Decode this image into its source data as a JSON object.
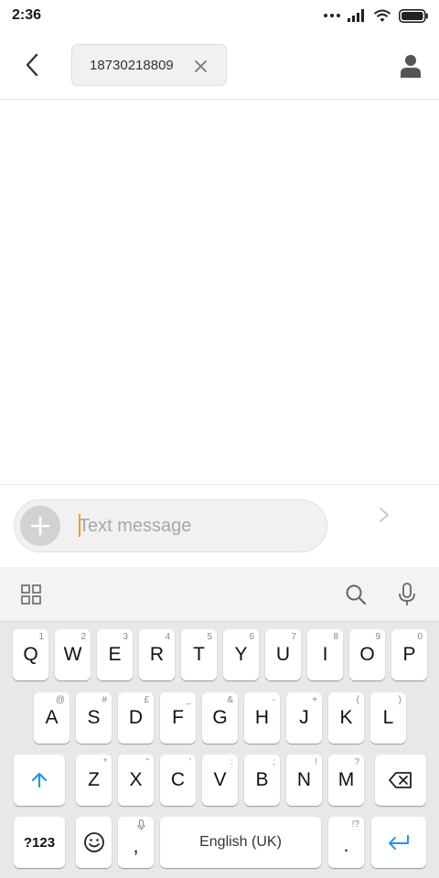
{
  "status_bar": {
    "time": "2:36"
  },
  "header": {
    "recipient": "18730218809"
  },
  "composer": {
    "placeholder": "Text message"
  },
  "keyboard": {
    "row1": [
      {
        "key": "Q",
        "sub": "1"
      },
      {
        "key": "W",
        "sub": "2"
      },
      {
        "key": "E",
        "sub": "3"
      },
      {
        "key": "R",
        "sub": "4"
      },
      {
        "key": "T",
        "sub": "5"
      },
      {
        "key": "Y",
        "sub": "6"
      },
      {
        "key": "U",
        "sub": "7"
      },
      {
        "key": "I",
        "sub": "8"
      },
      {
        "key": "O",
        "sub": "9"
      },
      {
        "key": "P",
        "sub": "0"
      }
    ],
    "row2": [
      {
        "key": "A",
        "sub": "@"
      },
      {
        "key": "S",
        "sub": "#"
      },
      {
        "key": "D",
        "sub": "£"
      },
      {
        "key": "F",
        "sub": "_"
      },
      {
        "key": "G",
        "sub": "&"
      },
      {
        "key": "H",
        "sub": "-"
      },
      {
        "key": "J",
        "sub": "+"
      },
      {
        "key": "K",
        "sub": "("
      },
      {
        "key": "L",
        "sub": ")"
      }
    ],
    "row3": [
      {
        "key": "Z",
        "sub": "*"
      },
      {
        "key": "X",
        "sub": "\""
      },
      {
        "key": "C",
        "sub": "'"
      },
      {
        "key": "V",
        "sub": ":"
      },
      {
        "key": "B",
        "sub": ";"
      },
      {
        "key": "N",
        "sub": "!"
      },
      {
        "key": "M",
        "sub": "?"
      }
    ],
    "symbols_label": "?123",
    "comma": ",",
    "period": ".",
    "period_sub": "!?",
    "space_label": "English (UK)"
  },
  "colors": {
    "accent": "#2196f3",
    "caret": "#f39c12"
  },
  "icons": {
    "back": "back-chevron-icon",
    "chip_remove": "close-icon",
    "contact": "person-icon",
    "attach": "plus-icon",
    "send": "send-chevron-icon",
    "grid": "grid-icon",
    "search": "search-icon",
    "mic": "microphone-icon",
    "shift": "shift-arrow-icon",
    "backspace": "backspace-icon",
    "emoji": "emoji-icon",
    "enter": "enter-icon"
  }
}
